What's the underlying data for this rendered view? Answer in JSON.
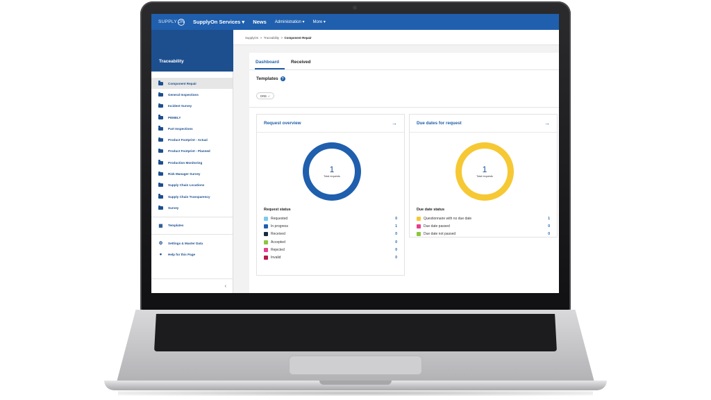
{
  "app": {
    "logo_text": "SUPPLY",
    "logo_suffix": "ON",
    "nav": [
      "SupplyOn Services ▾",
      "News",
      "Administration ▾",
      "More ▾"
    ]
  },
  "sidebar": {
    "title": "Traceability",
    "items": [
      {
        "label": "Component Repair",
        "active": true
      },
      {
        "label": "General Inspections"
      },
      {
        "label": "Incident Survey"
      },
      {
        "label": "PEMELY"
      },
      {
        "label": "Part Inspections"
      },
      {
        "label": "Product Footprint - Actual"
      },
      {
        "label": "Product Footprint - Planned"
      },
      {
        "label": "Production Monitoring"
      },
      {
        "label": "Risk Manager Survey"
      },
      {
        "label": "Supply Chain Locations"
      },
      {
        "label": "Supply Chain Transparency"
      },
      {
        "label": "Survey"
      }
    ],
    "templates_label": "Templates",
    "settings_label": "Settings & Master Data",
    "help_label": "Help for this Page",
    "collapse_glyph": "‹"
  },
  "breadcrumb": {
    "items": [
      "SupplyOn",
      "Traceability"
    ],
    "current": "Component Repair",
    "separator": ">"
  },
  "tabs": [
    {
      "label": "Dashboard",
      "active": true
    },
    {
      "label": "Received"
    }
  ],
  "templates": {
    "heading": "Templates",
    "help_glyph": "?",
    "chip_label": "DRB",
    "chip_check": "✓"
  },
  "request_overview": {
    "title": "Request overview",
    "arrow": "→",
    "total_value": "1",
    "total_label": "Total requests",
    "status_title": "Request status",
    "statuses": [
      {
        "label": "Requested",
        "count": "0",
        "color": "#7ec8ef"
      },
      {
        "label": "In progress",
        "count": "1",
        "color": "#1f5fad"
      },
      {
        "label": "Received",
        "count": "0",
        "color": "#1a2a3f"
      },
      {
        "label": "Accepted",
        "count": "0",
        "color": "#8cc63f"
      },
      {
        "label": "Rejected",
        "count": "0",
        "color": "#e83e8c"
      },
      {
        "label": "Invalid",
        "count": "0",
        "color": "#b5174e"
      }
    ]
  },
  "due_dates": {
    "title": "Due dates for request",
    "arrow": "→",
    "total_value": "1",
    "total_label": "Total requests",
    "status_title": "Due date status",
    "statuses": [
      {
        "label": "Questionnaire with no due date",
        "count": "1",
        "color": "#f6c833"
      },
      {
        "label": "Due date passed",
        "count": "0",
        "color": "#e83e8c"
      },
      {
        "label": "Due date not passed",
        "count": "0",
        "color": "#8cc63f"
      }
    ]
  },
  "colors": {
    "brand": "#1f5fad",
    "sidebar_head": "#1d4f8f",
    "donut_blue": "#1f5fad",
    "donut_yellow": "#f6c833"
  }
}
